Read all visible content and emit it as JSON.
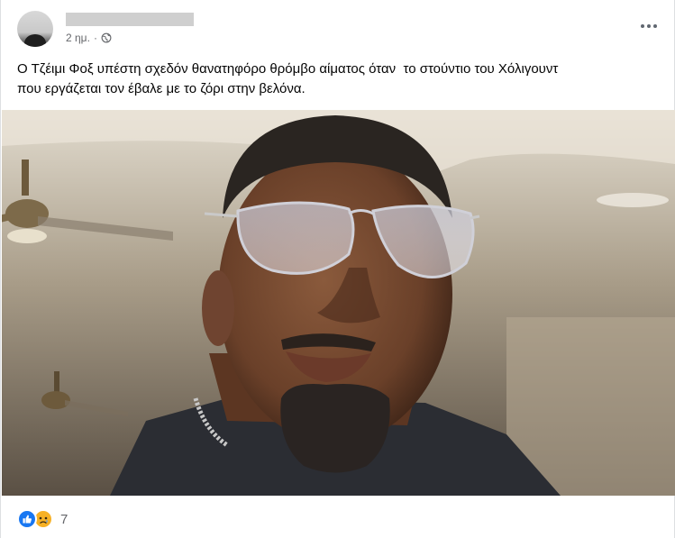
{
  "post": {
    "author_name": "",
    "timestamp": "2 ημ.",
    "separator": "·",
    "audience_icon": "globe-icon",
    "text": "Ο Τζέιμι Φοξ υπέστη σχεδόν θανατηφόρο θρόμβο αίματος όταν  το στούντιο του Χόλιγουντ\nπου εργάζεται τον έβαλε με το ζόρι στην βελόνα.",
    "photo_icon": "portrait-photo"
  },
  "reactions": {
    "icons": [
      "like-icon",
      "sad-icon"
    ],
    "count": "7"
  },
  "colors": {
    "accent": "#1877f2",
    "secondary_text": "#65676b",
    "sad_yellow": "#f7b125"
  }
}
